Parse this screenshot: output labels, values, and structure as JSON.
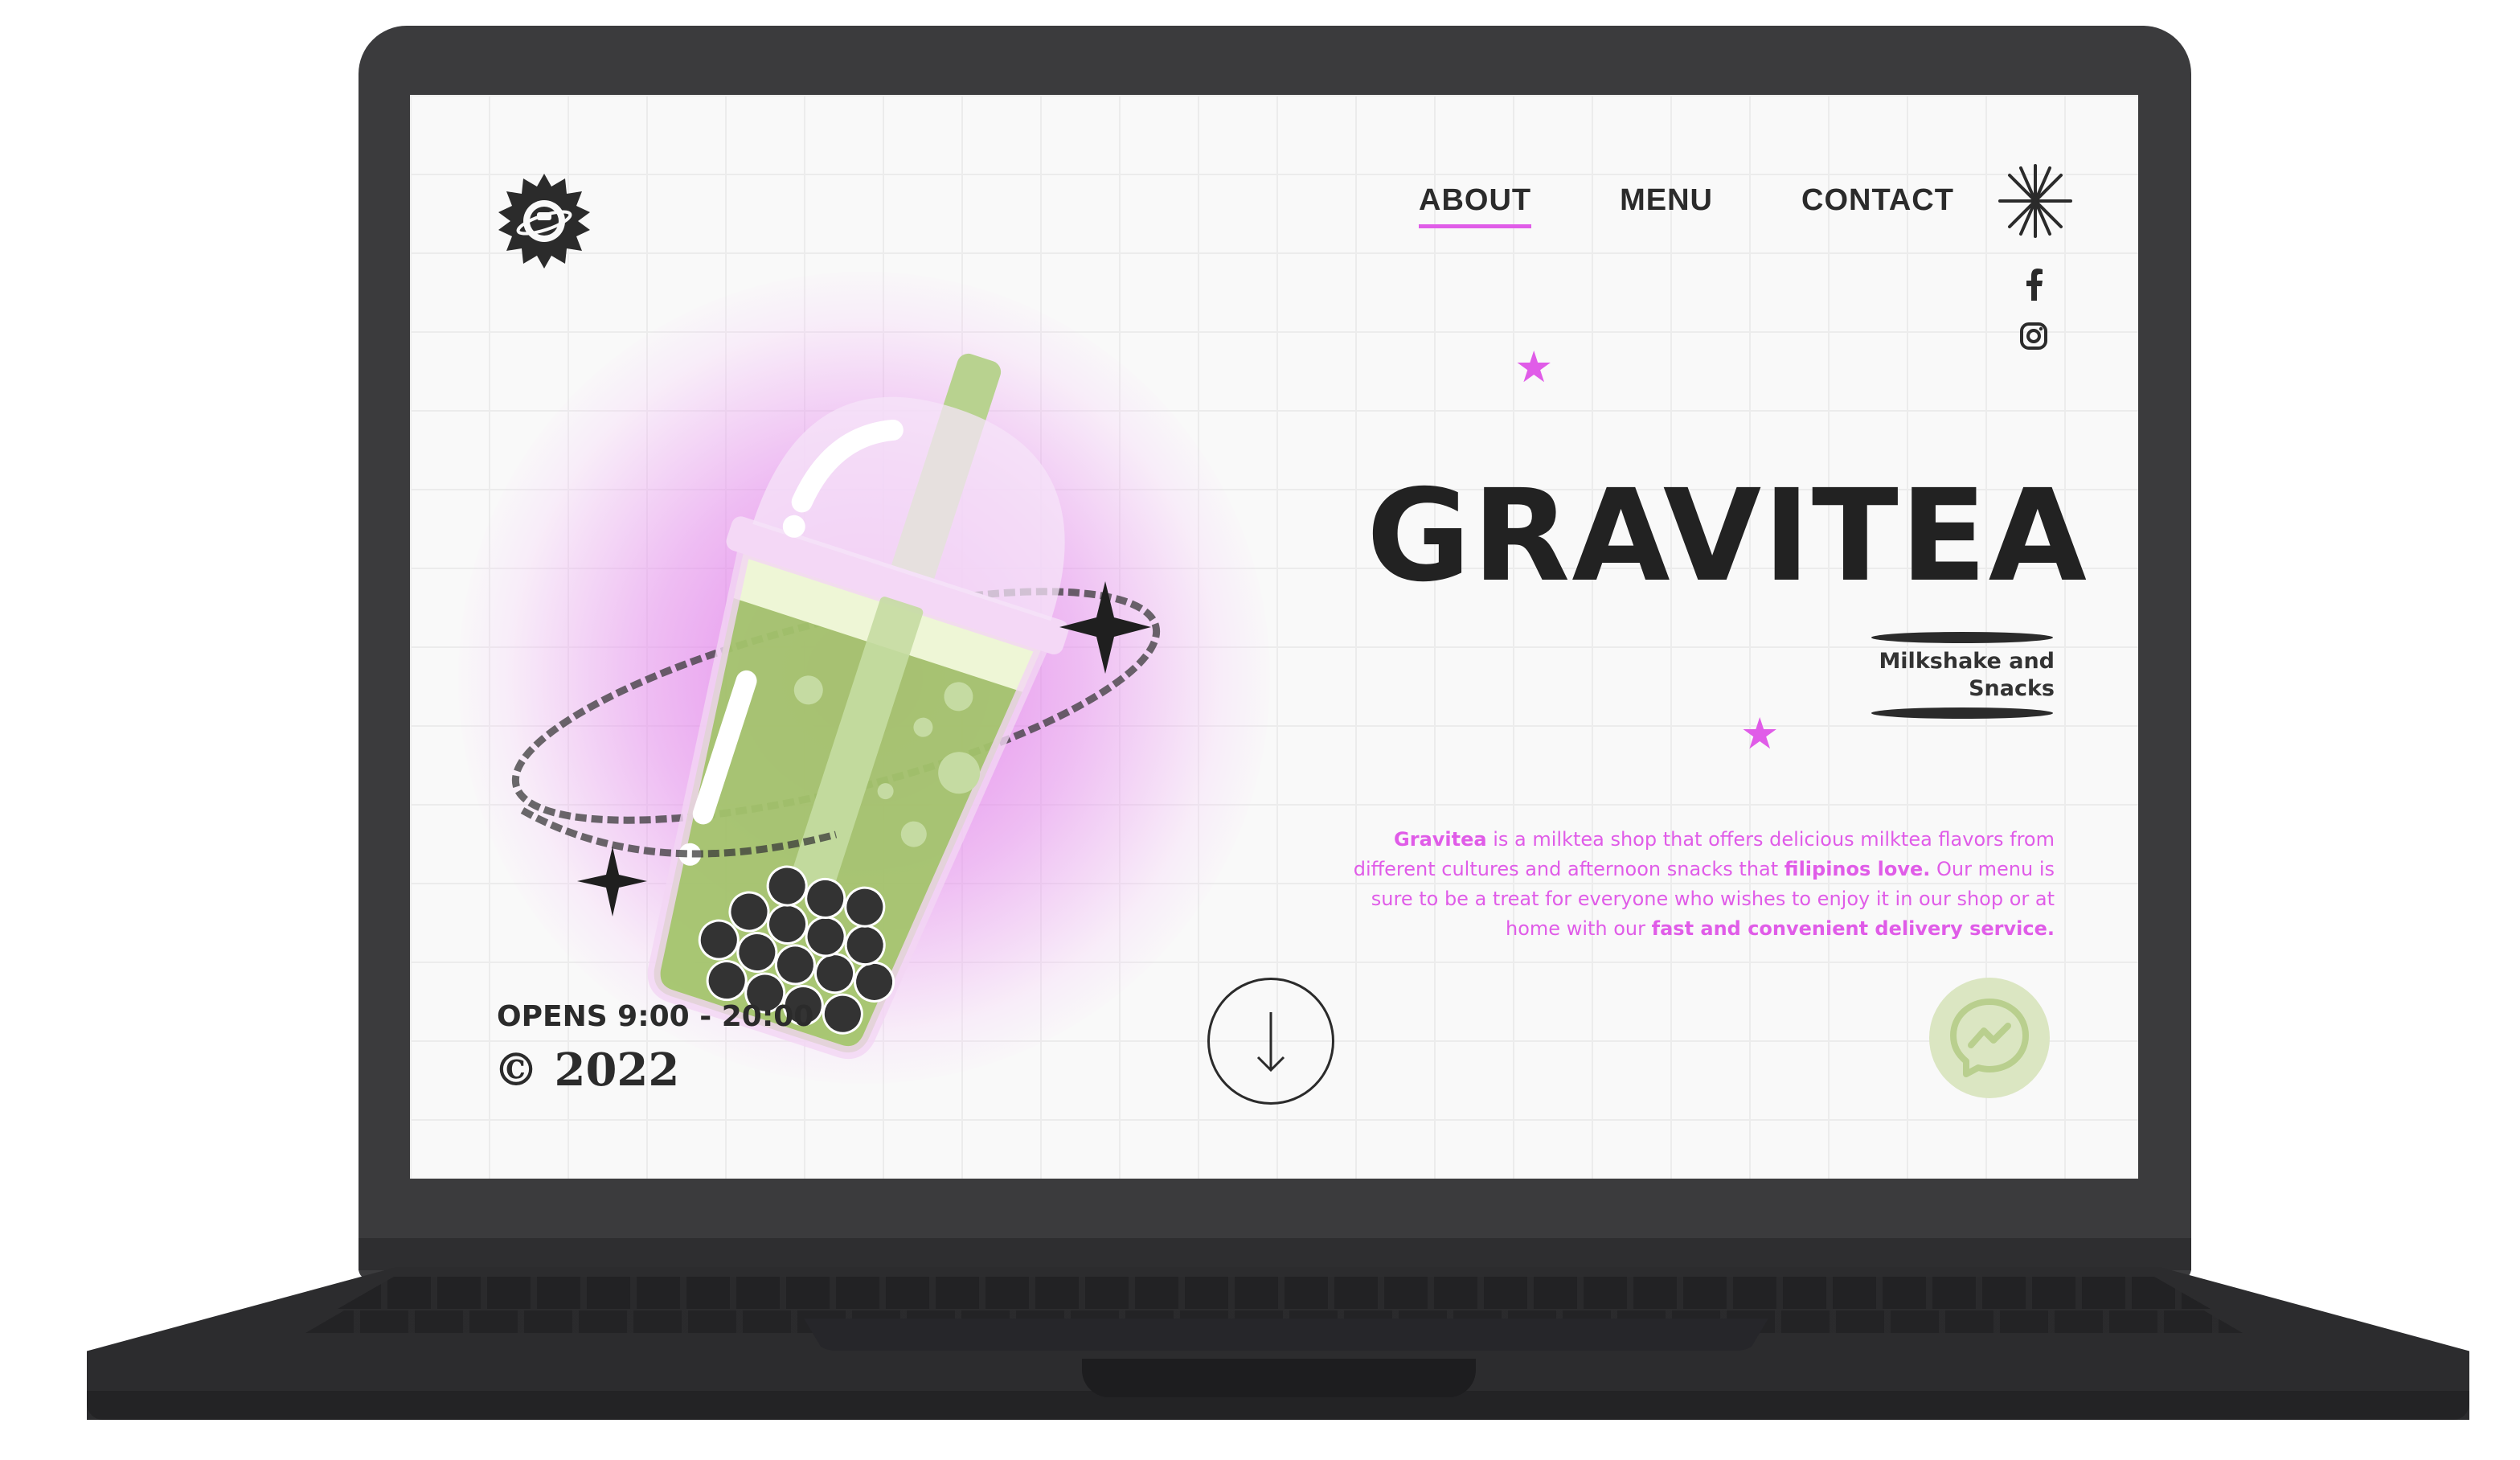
{
  "nav": {
    "items": [
      {
        "label": "ABOUT",
        "active": true
      },
      {
        "label": "MENU",
        "active": false
      },
      {
        "label": "CONTACT",
        "active": false
      }
    ]
  },
  "social": {
    "facebook_icon": "facebook-icon",
    "instagram_icon": "instagram-icon"
  },
  "hero": {
    "title": "GRAVITEA",
    "subtitle_line1": "Milkshake and",
    "subtitle_line2": "Snacks",
    "description": {
      "p1_bold": "Gravitea",
      "p1": " is a milktea shop that offers delicious milktea flavors from different cultures and afternoon snacks that ",
      "p2_bold": "filipinos love.",
      "p2": " Our menu is sure to be a treat for everyone who wishes to enjoy it in our shop or at home with our ",
      "p3_bold": "fast and convenient delivery service."
    }
  },
  "footer": {
    "hours": "OPENS 9:00 - 20:00",
    "copyright": "© 2022"
  },
  "icons": {
    "logo": "planet-logo-icon",
    "scroll": "arrow-down-icon",
    "messenger": "messenger-icon",
    "nav_sparkle": "sparkle-icon"
  },
  "colors": {
    "accent": "#e05ce8",
    "matcha": "#a3c46b",
    "dark": "#2b2b2b",
    "frame": "#3b3b3d"
  }
}
